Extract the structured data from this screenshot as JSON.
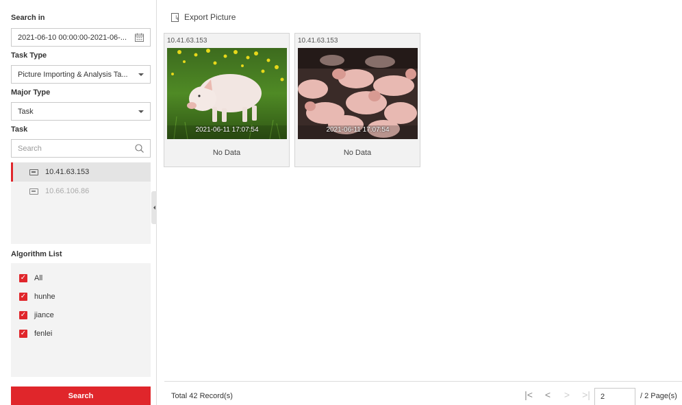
{
  "sidebar": {
    "search_in_label": "Search in",
    "date_range": "2021-06-10 00:00:00-2021-06-...",
    "task_type_label": "Task Type",
    "task_type_value": "Picture Importing & Analysis Ta...",
    "major_type_label": "Major Type",
    "major_type_value": "Task",
    "task_label": "Task",
    "search_placeholder": "Search",
    "tasks": [
      {
        "label": "10.41.63.153",
        "state": "selected"
      },
      {
        "label": "10.66.106.86",
        "state": "disabled"
      }
    ],
    "algorithm_label": "Algorithm List",
    "algorithms": [
      {
        "label": "All",
        "checked": true
      },
      {
        "label": "hunhe",
        "checked": true
      },
      {
        "label": "jiance",
        "checked": true
      },
      {
        "label": "fenlei",
        "checked": true
      }
    ],
    "search_button": "Search"
  },
  "toolbar": {
    "export_label": "Export Picture"
  },
  "results": [
    {
      "ip": "10.41.63.153",
      "timestamp": "2021-06-11 17:07:54",
      "status": "No Data",
      "image": "piglet-on-grass"
    },
    {
      "ip": "10.41.63.153",
      "timestamp": "2021-06-11 17:07:54",
      "status": "No Data",
      "image": "piglets-pen"
    }
  ],
  "footer": {
    "total": "Total 42 Record(s)",
    "current_page": "2",
    "page_total": "/ 2 Page(s)"
  },
  "colors": {
    "accent": "#e0262b",
    "panel_bg": "#f3f3f3"
  }
}
